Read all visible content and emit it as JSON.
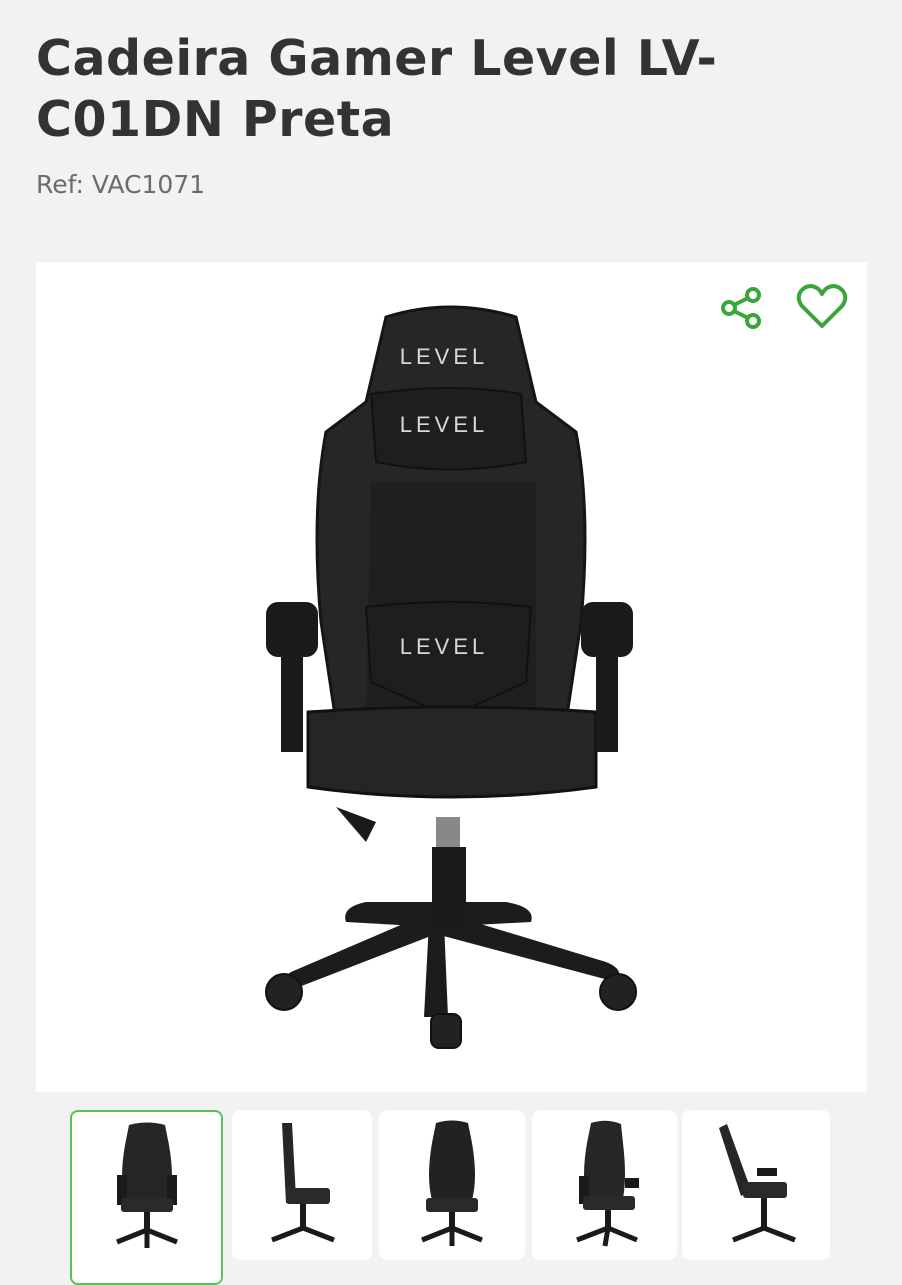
{
  "product": {
    "title": "Cadeira Gamer Level LV-C01DN Preta",
    "ref": "Ref: VAC1071",
    "logo_text": "LEVEL"
  },
  "actions": {
    "share_icon": "share-icon",
    "favorite_icon": "heart-icon",
    "accent_color": "#3aa63a"
  },
  "gallery": {
    "thumbnail_count": 5,
    "active_index": 0,
    "views": [
      "front",
      "side",
      "back",
      "front-angled",
      "side-reclined"
    ]
  }
}
